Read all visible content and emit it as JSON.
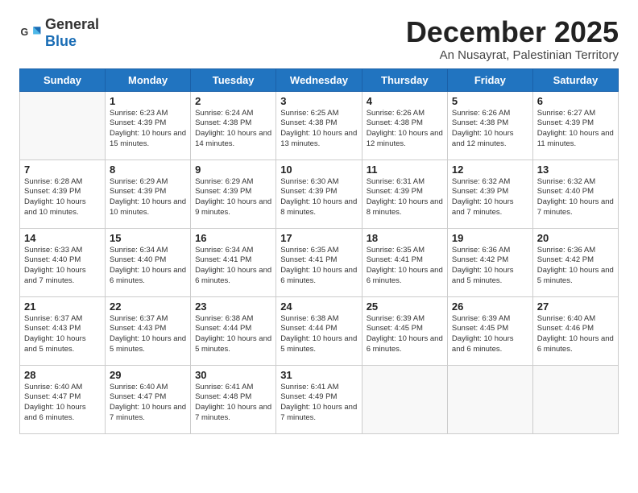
{
  "logo": {
    "general": "General",
    "blue": "Blue"
  },
  "header": {
    "month": "December 2025",
    "location": "An Nusayrat, Palestinian Territory"
  },
  "days_of_week": [
    "Sunday",
    "Monday",
    "Tuesday",
    "Wednesday",
    "Thursday",
    "Friday",
    "Saturday"
  ],
  "weeks": [
    [
      {
        "day": "",
        "info": ""
      },
      {
        "day": "1",
        "info": "Sunrise: 6:23 AM\nSunset: 4:39 PM\nDaylight: 10 hours\nand 15 minutes."
      },
      {
        "day": "2",
        "info": "Sunrise: 6:24 AM\nSunset: 4:38 PM\nDaylight: 10 hours\nand 14 minutes."
      },
      {
        "day": "3",
        "info": "Sunrise: 6:25 AM\nSunset: 4:38 PM\nDaylight: 10 hours\nand 13 minutes."
      },
      {
        "day": "4",
        "info": "Sunrise: 6:26 AM\nSunset: 4:38 PM\nDaylight: 10 hours\nand 12 minutes."
      },
      {
        "day": "5",
        "info": "Sunrise: 6:26 AM\nSunset: 4:38 PM\nDaylight: 10 hours\nand 12 minutes."
      },
      {
        "day": "6",
        "info": "Sunrise: 6:27 AM\nSunset: 4:39 PM\nDaylight: 10 hours\nand 11 minutes."
      }
    ],
    [
      {
        "day": "7",
        "info": "Sunrise: 6:28 AM\nSunset: 4:39 PM\nDaylight: 10 hours\nand 10 minutes."
      },
      {
        "day": "8",
        "info": "Sunrise: 6:29 AM\nSunset: 4:39 PM\nDaylight: 10 hours\nand 10 minutes."
      },
      {
        "day": "9",
        "info": "Sunrise: 6:29 AM\nSunset: 4:39 PM\nDaylight: 10 hours\nand 9 minutes."
      },
      {
        "day": "10",
        "info": "Sunrise: 6:30 AM\nSunset: 4:39 PM\nDaylight: 10 hours\nand 8 minutes."
      },
      {
        "day": "11",
        "info": "Sunrise: 6:31 AM\nSunset: 4:39 PM\nDaylight: 10 hours\nand 8 minutes."
      },
      {
        "day": "12",
        "info": "Sunrise: 6:32 AM\nSunset: 4:39 PM\nDaylight: 10 hours\nand 7 minutes."
      },
      {
        "day": "13",
        "info": "Sunrise: 6:32 AM\nSunset: 4:40 PM\nDaylight: 10 hours\nand 7 minutes."
      }
    ],
    [
      {
        "day": "14",
        "info": "Sunrise: 6:33 AM\nSunset: 4:40 PM\nDaylight: 10 hours\nand 7 minutes."
      },
      {
        "day": "15",
        "info": "Sunrise: 6:34 AM\nSunset: 4:40 PM\nDaylight: 10 hours\nand 6 minutes."
      },
      {
        "day": "16",
        "info": "Sunrise: 6:34 AM\nSunset: 4:41 PM\nDaylight: 10 hours\nand 6 minutes."
      },
      {
        "day": "17",
        "info": "Sunrise: 6:35 AM\nSunset: 4:41 PM\nDaylight: 10 hours\nand 6 minutes."
      },
      {
        "day": "18",
        "info": "Sunrise: 6:35 AM\nSunset: 4:41 PM\nDaylight: 10 hours\nand 6 minutes."
      },
      {
        "day": "19",
        "info": "Sunrise: 6:36 AM\nSunset: 4:42 PM\nDaylight: 10 hours\nand 5 minutes."
      },
      {
        "day": "20",
        "info": "Sunrise: 6:36 AM\nSunset: 4:42 PM\nDaylight: 10 hours\nand 5 minutes."
      }
    ],
    [
      {
        "day": "21",
        "info": "Sunrise: 6:37 AM\nSunset: 4:43 PM\nDaylight: 10 hours\nand 5 minutes."
      },
      {
        "day": "22",
        "info": "Sunrise: 6:37 AM\nSunset: 4:43 PM\nDaylight: 10 hours\nand 5 minutes."
      },
      {
        "day": "23",
        "info": "Sunrise: 6:38 AM\nSunset: 4:44 PM\nDaylight: 10 hours\nand 5 minutes."
      },
      {
        "day": "24",
        "info": "Sunrise: 6:38 AM\nSunset: 4:44 PM\nDaylight: 10 hours\nand 5 minutes."
      },
      {
        "day": "25",
        "info": "Sunrise: 6:39 AM\nSunset: 4:45 PM\nDaylight: 10 hours\nand 6 minutes."
      },
      {
        "day": "26",
        "info": "Sunrise: 6:39 AM\nSunset: 4:45 PM\nDaylight: 10 hours\nand 6 minutes."
      },
      {
        "day": "27",
        "info": "Sunrise: 6:40 AM\nSunset: 4:46 PM\nDaylight: 10 hours\nand 6 minutes."
      }
    ],
    [
      {
        "day": "28",
        "info": "Sunrise: 6:40 AM\nSunset: 4:47 PM\nDaylight: 10 hours\nand 6 minutes."
      },
      {
        "day": "29",
        "info": "Sunrise: 6:40 AM\nSunset: 4:47 PM\nDaylight: 10 hours\nand 7 minutes."
      },
      {
        "day": "30",
        "info": "Sunrise: 6:41 AM\nSunset: 4:48 PM\nDaylight: 10 hours\nand 7 minutes."
      },
      {
        "day": "31",
        "info": "Sunrise: 6:41 AM\nSunset: 4:49 PM\nDaylight: 10 hours\nand 7 minutes."
      },
      {
        "day": "",
        "info": ""
      },
      {
        "day": "",
        "info": ""
      },
      {
        "day": "",
        "info": ""
      }
    ]
  ]
}
